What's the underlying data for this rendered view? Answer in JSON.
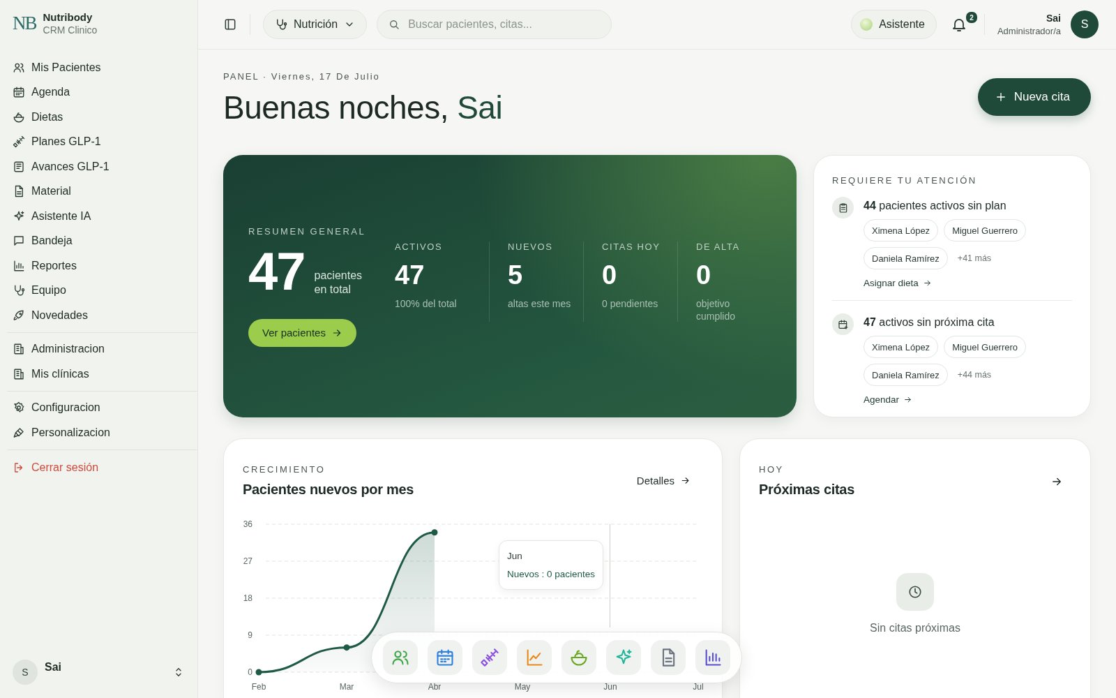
{
  "brand": {
    "logo": "NB",
    "name": "Nutribody",
    "subtitle": "CRM Clinico"
  },
  "sidebar": {
    "groups": [
      [
        "Mis Pacientes",
        "Agenda",
        "Dietas",
        "Planes GLP-1",
        "Avances GLP-1",
        "Material",
        "Asistente IA",
        "Bandeja",
        "Reportes",
        "Equipo",
        "Novedades"
      ],
      [
        "Administracion",
        "Mis clínicas"
      ],
      [
        "Configuracion",
        "Personalizacion"
      ]
    ],
    "logout": "Cerrar sesión",
    "user": {
      "initial": "S",
      "name": "Sai"
    }
  },
  "topbar": {
    "specialty": "Nutrición",
    "search": {
      "placeholder": "Buscar pacientes, citas..."
    },
    "assistant": "Asistente",
    "notifications": "2",
    "user": {
      "name": "Sai",
      "role": "Administrador/a",
      "initial": "S"
    }
  },
  "header": {
    "eyebrow": "PANEL · Viernes, 17 De Julio",
    "greeting": "Buenas noches, ",
    "greeting_name": "Sai",
    "new_button": "Nueva cita"
  },
  "summary": {
    "label": "RESUMEN GENERAL",
    "total": "47",
    "total_caption": "pacientes en total",
    "button": "Ver pacientes",
    "stats": [
      {
        "label": "ACTIVOS",
        "value": "47",
        "caption": "100% del total"
      },
      {
        "label": "NUEVOS",
        "value": "5",
        "caption": "altas este mes"
      },
      {
        "label": "CITAS HOY",
        "value": "0",
        "caption": "0 pendientes"
      },
      {
        "label": "DE ALTA",
        "value": "0",
        "caption": "objetivo cumplido"
      }
    ]
  },
  "attention": {
    "title": "REQUIERE TU ATENCIÓN",
    "items": [
      {
        "text": "**44** pacientes activos sin plan",
        "patients": [
          "Ximena López",
          "Miguel Guerrero",
          "Daniela Ramírez"
        ],
        "more": "+41 más",
        "action": "Asignar dieta"
      },
      {
        "text": "**47** activos sin próxima cita",
        "patients": [
          "Ximena López",
          "Miguel Guerrero",
          "Daniela Ramírez"
        ],
        "more": "+44 más",
        "action": "Agendar"
      }
    ]
  },
  "growth": {
    "eyebrow": "CRECIMIENTO",
    "title": "Pacientes nuevos por mes",
    "link": "Detalles",
    "chart_data": {
      "type": "area",
      "categories": [
        "Feb",
        "Mar",
        "Abr",
        "May",
        "Jun",
        "Jul"
      ],
      "series": [
        {
          "name": "Nuevos",
          "color": "#1f5a45",
          "values": [
            0,
            6,
            34,
            null,
            null,
            null
          ]
        }
      ],
      "ylim": [
        0,
        36
      ],
      "yticks": [
        0,
        9,
        18,
        27,
        36
      ],
      "grid": true
    },
    "tooltip": {
      "title": "Jun",
      "text": ": 0 pacientes"
    }
  },
  "today": {
    "eyebrow": "HOY",
    "title": "Próximas citas",
    "empty": "Sin citas próximas"
  }
}
